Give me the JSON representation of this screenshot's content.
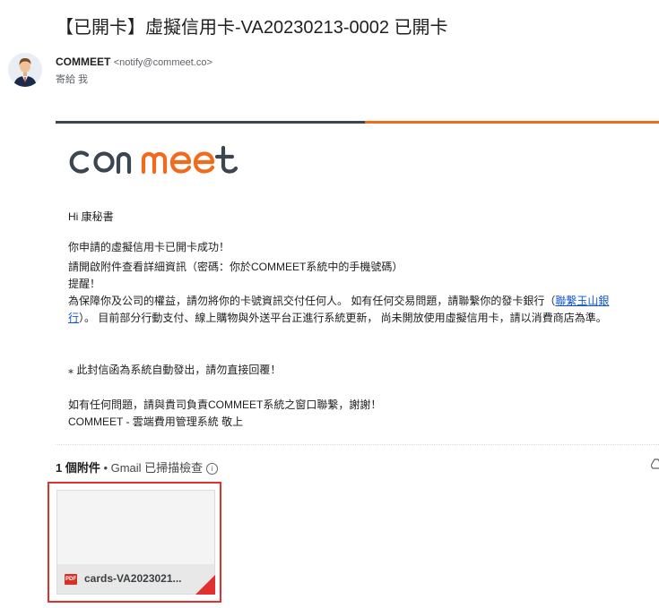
{
  "email": {
    "subject": "【已開卡】虛擬信用卡-VA20230213-0002 已開卡",
    "sender_name": "COMMEET",
    "sender_address": "<notify@commeet.co>",
    "recipient_line": "寄給 我"
  },
  "logo_text": "commeet",
  "body": {
    "greeting": "Hi 康秘書",
    "line1": "你申請的虛擬信用卡已開卡成功！",
    "line2": "請開啟附件查看詳細資訊（密碼：你於COMMEET系統中的手機號碼）",
    "line3": "提醒！",
    "line4_prefix": "為保障你及公司的權益，請勿將你的卡號資訊交付任何人。 如有任何交易問題，請聯繫你的發卡銀行（",
    "bank_link_part1": "聯繫玉山銀",
    "bank_link_part2": "行",
    "line5_suffix": "）。 目前部分行動支付、線上購物與外送平台正進行系統更新， 尚未開放使用虛擬信用卡，請以消費商店為準。",
    "notice": "⁎ 此封信函為系統自動發出，請勿直接回覆！",
    "contact": "如有任何問題，請與貴司負責COMMEET系統之窗口聯繫，謝謝！",
    "signature": "COMMEET - 雲端費用管理系統 敬上"
  },
  "attachments": {
    "count_label": "1 個附件",
    "scan_label": " • Gmail 已掃描檢查",
    "info_icon": "ⓘ",
    "files": [
      {
        "type_badge": "PDF",
        "name": "cards-VA2023021..."
      }
    ]
  },
  "colors": {
    "brand_dark": "#3c4650",
    "brand_orange": "#f26b1d",
    "highlight": "#e03030",
    "link": "#1155cc"
  }
}
